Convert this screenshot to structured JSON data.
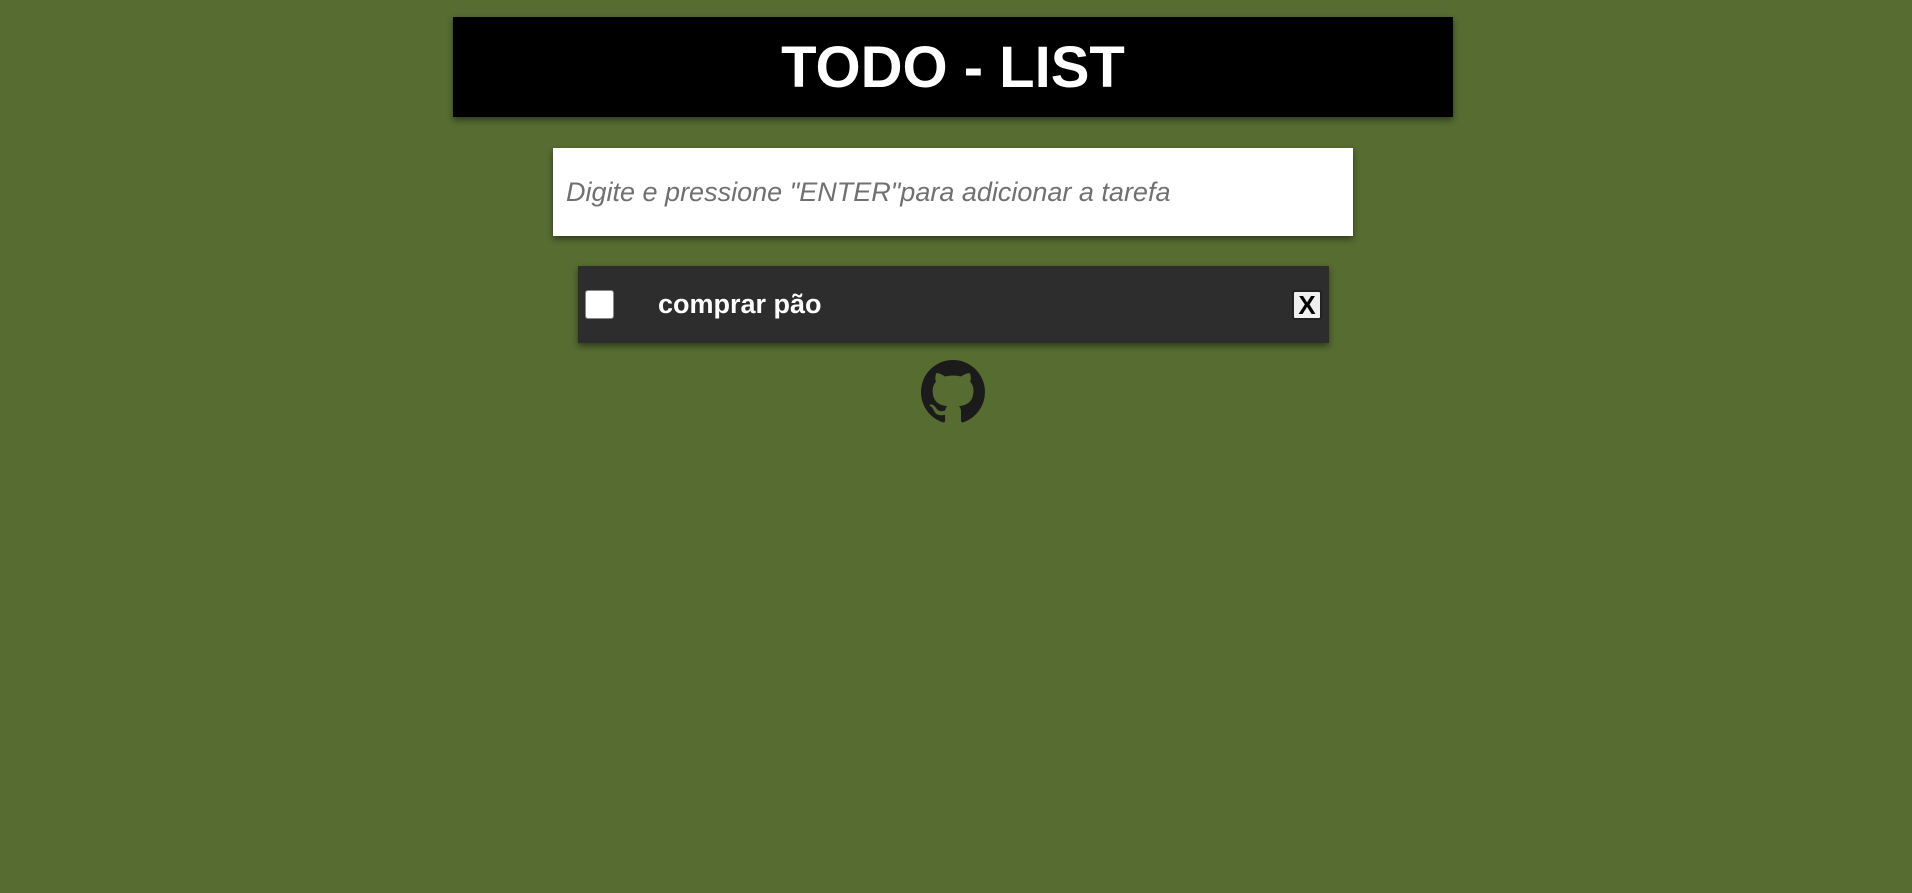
{
  "header": {
    "title": "TODO - LIST"
  },
  "task_input": {
    "value": "",
    "placeholder": "Digite e pressione \"ENTER\"para adicionar a tarefa"
  },
  "todos": [
    {
      "text": "comprar pão",
      "checked": false,
      "delete_label": "X"
    }
  ],
  "footer": {
    "github_icon": "github-icon"
  },
  "colors": {
    "background": "#566c31",
    "header_bg": "#000000",
    "item_bg": "#2d2d2d",
    "text_light": "#ffffff"
  }
}
